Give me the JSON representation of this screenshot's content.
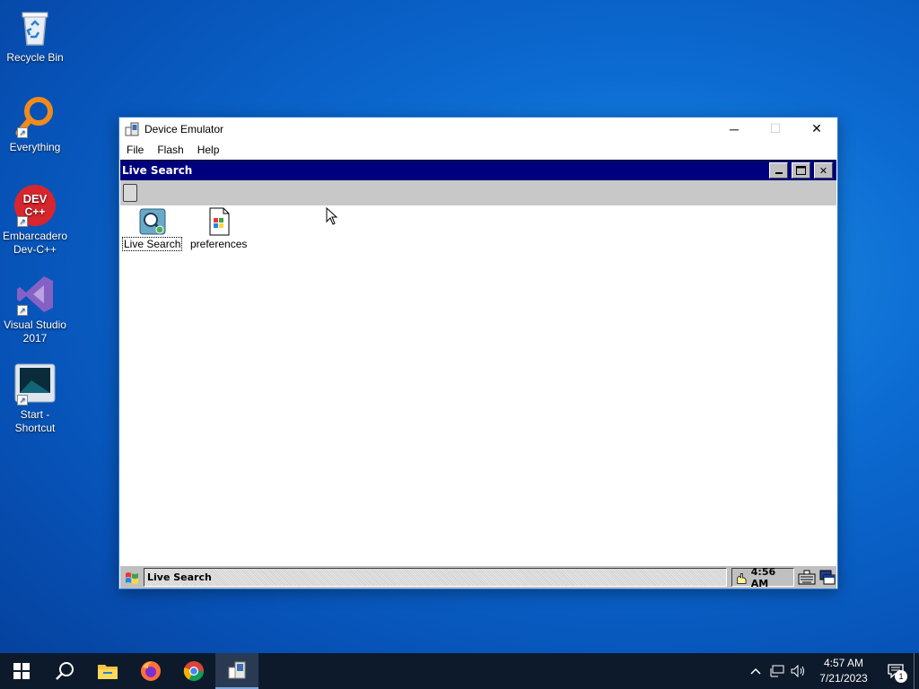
{
  "desktop": {
    "icons": [
      {
        "label": "Recycle Bin",
        "icon": "recycle-bin-icon"
      },
      {
        "label": "Everything",
        "icon": "everything-search-icon"
      },
      {
        "label": "Embarcadero Dev-C++",
        "icon": "dev-cpp-icon",
        "badge": "DEV C++"
      },
      {
        "label": "Visual Studio 2017",
        "icon": "visual-studio-icon"
      },
      {
        "label": "Start - Shortcut",
        "icon": "start-shortcut-icon"
      }
    ]
  },
  "emulator": {
    "title": "Device Emulator",
    "menu": [
      "File",
      "Flash",
      "Help"
    ],
    "ce": {
      "caption": "Live Search",
      "files": [
        {
          "label": "Live Search",
          "icon": "live-search-icon"
        },
        {
          "label": "preferences",
          "icon": "document-icon"
        }
      ],
      "taskbar": {
        "task": "Live Search",
        "time": "4:56 AM"
      }
    }
  },
  "taskbar": {
    "pinned": [
      "start-icon",
      "search-icon",
      "file-explorer-icon",
      "firefox-icon",
      "chrome-icon",
      "device-emulator-icon"
    ],
    "clock_time": "4:57 AM",
    "clock_date": "7/21/2023",
    "notification_count": "1"
  },
  "colors": {
    "ce_caption": "#00007f",
    "ce_gray": "#c0c0c0",
    "taskbar": "#0d1a2b",
    "desktop_blue": "#0c6bd1"
  }
}
